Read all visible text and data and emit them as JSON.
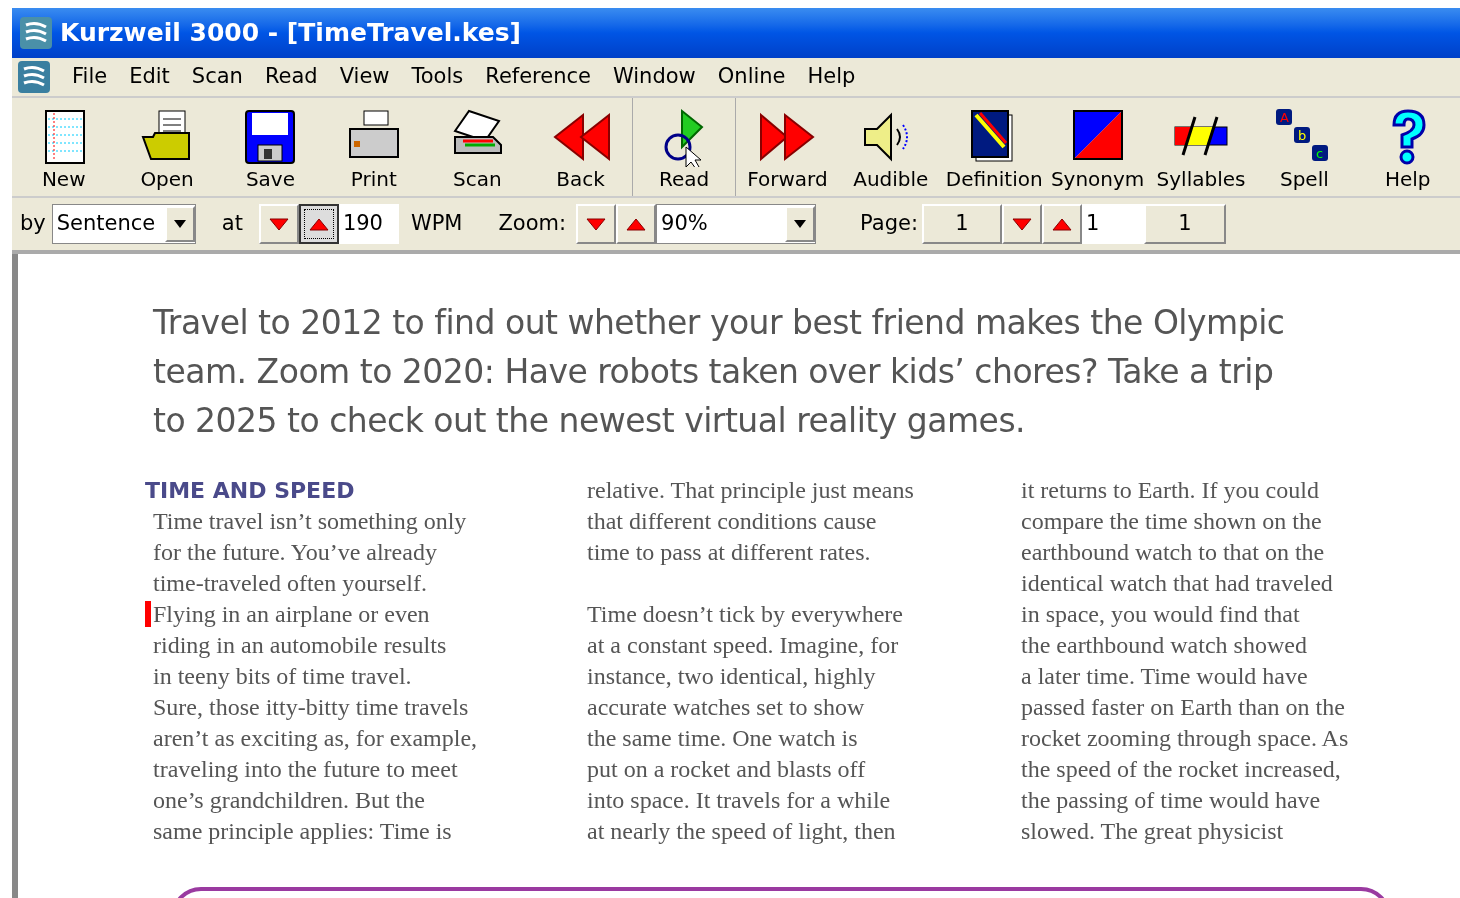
{
  "window": {
    "title": "Kurzweil 3000 - [TimeTravel.kes]"
  },
  "menu": [
    "File",
    "Edit",
    "Scan",
    "Read",
    "View",
    "Tools",
    "Reference",
    "Window",
    "Online",
    "Help"
  ],
  "toolbar": [
    {
      "label": "New",
      "kind": "new"
    },
    {
      "label": "Open",
      "kind": "open"
    },
    {
      "label": "Save",
      "kind": "save"
    },
    {
      "label": "Print",
      "kind": "print"
    },
    {
      "label": "Scan",
      "kind": "scan"
    },
    {
      "label": "Back",
      "kind": "back"
    },
    {
      "label": "Read",
      "kind": "read"
    },
    {
      "label": "Forward",
      "kind": "forward"
    },
    {
      "label": "Audible",
      "kind": "audible"
    },
    {
      "label": "Definition",
      "kind": "definition"
    },
    {
      "label": "Synonym",
      "kind": "synonym"
    },
    {
      "label": "Syllables",
      "kind": "syllables"
    },
    {
      "label": "Spell",
      "kind": "spell",
      "icon_letters": [
        "A",
        "b",
        "c"
      ]
    },
    {
      "label": "Help",
      "kind": "help"
    }
  ],
  "reading_bar": {
    "by_label": "by",
    "unit": "Sentence",
    "at_label": "at",
    "speed_buttons": [
      {
        "kind": "down",
        "pressed": false
      },
      {
        "kind": "up",
        "pressed": true
      }
    ],
    "speed": "190",
    "speed_unit": "WPM",
    "zoom_label": "Zoom:",
    "zoom": "90%",
    "page_label": "Page:",
    "page": "1",
    "page_input": "1",
    "page_total": "1"
  },
  "document": {
    "headline": [
      "Travel to 2012 to find out whether your best friend makes the Olympic",
      "team. Zoom to 2020: Have robots taken over kids’ chores? Take a trip",
      "to 2025 to check out the newest virtual reality games."
    ],
    "columns": [
      {
        "heading": "TIME AND SPEED",
        "paragraphs": [
          [
            {
              "text": "Time travel isn’t something only",
              "marked": false
            },
            {
              "text": "for the future.  You’ve already",
              "marked": false
            },
            {
              "text": "time-traveled often yourself.",
              "marked": false
            },
            {
              "text": "Flying in an airplane or even",
              "marked": true
            },
            {
              "text": "riding in an automobile results",
              "marked": false
            },
            {
              "text": "in teeny bits of time travel.",
              "marked": false
            },
            {
              "text": "Sure, those itty-bitty time travels",
              "marked": false
            },
            {
              "text": "aren’t as exciting as,  for example,",
              "marked": false
            },
            {
              "text": "traveling into the future to meet",
              "marked": false
            },
            {
              "text": "one’s grandchildren. But the",
              "marked": false
            },
            {
              "text": "same principle applies:  Time is",
              "marked": false
            }
          ]
        ]
      },
      {
        "paragraphs": [
          [
            {
              "text": "relative.  That principle just means",
              "marked": false
            },
            {
              "text": "that different conditions cause",
              "marked": false
            },
            {
              "text": "time to pass at different rates.",
              "marked": false
            }
          ],
          [
            {
              "text": "Time doesn’t tick by everywhere",
              "marked": false
            },
            {
              "text": "at a constant speed.  Imagine, for",
              "marked": false
            },
            {
              "text": "instance, two identical, highly",
              "marked": false
            },
            {
              "text": "accurate watches set to show",
              "marked": false
            },
            {
              "text": "the same time. One watch is",
              "marked": false
            },
            {
              "text": "put on a rocket and blasts off",
              "marked": false
            },
            {
              "text": "into space.  It travels for a while",
              "marked": false
            },
            {
              "text": "at nearly the speed of light, then",
              "marked": false
            }
          ]
        ]
      },
      {
        "paragraphs": [
          [
            {
              "text": "it returns to Earth. If you could",
              "marked": false
            },
            {
              "text": "compare the time shown on the",
              "marked": false
            },
            {
              "text": "earthbound watch to that on the",
              "marked": false
            },
            {
              "text": "identical watch that had traveled",
              "marked": false
            },
            {
              "text": "in space, you would find that",
              "marked": false
            },
            {
              "text": "the earthbound watch showed",
              "marked": false
            },
            {
              "text": "a later time.  Time would have",
              "marked": false
            },
            {
              "text": "passed faster on Earth than on the",
              "marked": false
            },
            {
              "text": "rocket zooming through space.  As",
              "marked": false
            },
            {
              "text": "the speed of the rocket increased,",
              "marked": false
            },
            {
              "text": "the passing of time would have",
              "marked": false
            },
            {
              "text": "slowed.  The great physicist",
              "marked": false
            }
          ]
        ]
      }
    ]
  }
}
